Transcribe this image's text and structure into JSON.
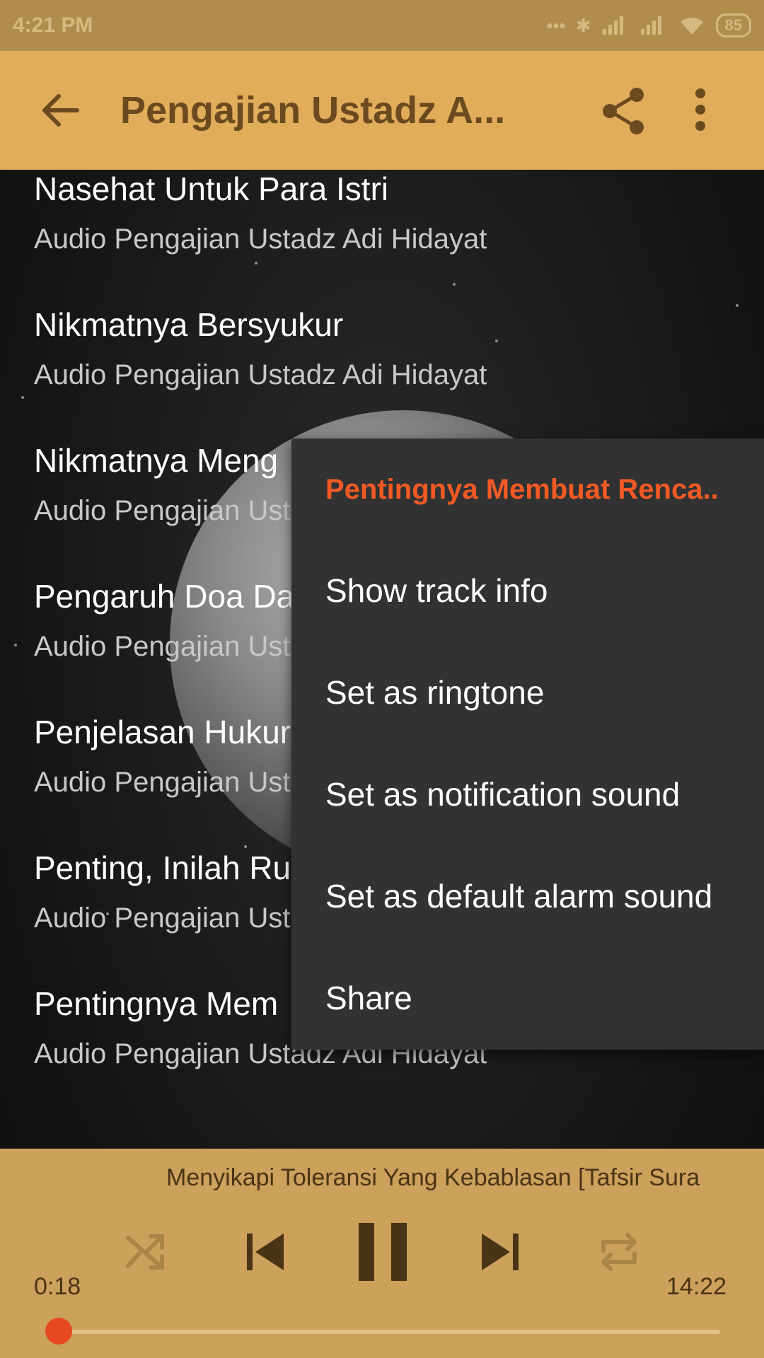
{
  "status_bar": {
    "time": "4:21 PM",
    "battery": "85"
  },
  "app_bar": {
    "title": "Pengajian Ustadz A..."
  },
  "tracks": [
    {
      "title": "Nasehat Untuk Para Istri",
      "subtitle": "Audio Pengajian Ustadz Adi Hidayat"
    },
    {
      "title": "Nikmatnya Bersyukur",
      "subtitle": "Audio Pengajian Ustadz Adi Hidayat"
    },
    {
      "title": "Nikmatnya Meng",
      "subtitle": "Audio Pengajian Ust"
    },
    {
      "title": "Pengaruh Doa Da",
      "subtitle": "Audio Pengajian Ust"
    },
    {
      "title": "Penjelasan Hukur",
      "subtitle": "Audio Pengajian Ust"
    },
    {
      "title": "Penting, Inilah Ru",
      "subtitle": "Audio Pengajian Ust"
    },
    {
      "title": "Pentingnya Mem",
      "subtitle": "Audio Pengajian Ustadz Adi Hidayat"
    }
  ],
  "context_menu": {
    "header": "Pentingnya Membuat Renca..",
    "items": [
      "Show track info",
      "Set as ringtone",
      "Set as notification sound",
      "Set as default alarm sound",
      "Share"
    ]
  },
  "player": {
    "now_playing": "Menyikapi Toleransi Yang Kebablasan [Tafsir Sura",
    "elapsed": "0:18",
    "duration": "14:22",
    "progress_fraction": 0.021
  },
  "colors": {
    "accent": "#f15a24",
    "app_bar": "#e1ad5b",
    "status_bar": "#b08d4c",
    "player_bg": "#cba15c",
    "menu_bg": "#323232"
  }
}
